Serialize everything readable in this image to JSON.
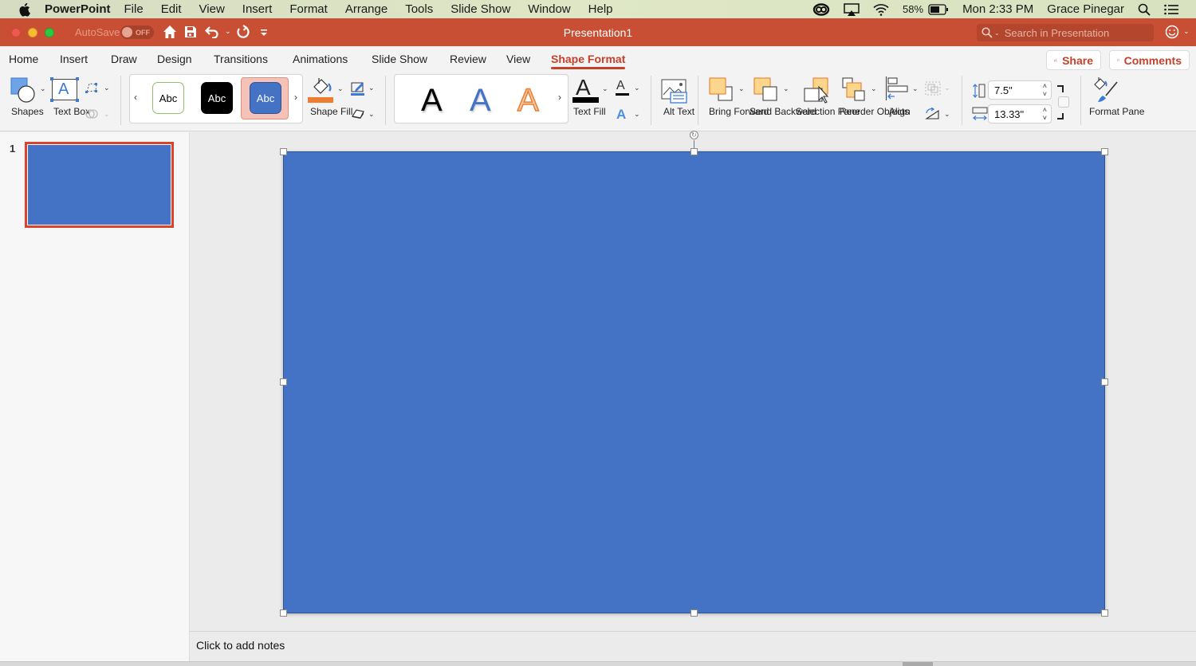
{
  "menubar": {
    "app_name": "PowerPoint",
    "items": [
      "File",
      "Edit",
      "View",
      "Insert",
      "Format",
      "Arrange",
      "Tools",
      "Slide Show",
      "Window",
      "Help"
    ],
    "battery": "58%",
    "clock": "Mon 2:33 PM",
    "user": "Grace Pinegar"
  },
  "titlebar": {
    "autosave_label": "AutoSave",
    "autosave_state": "OFF",
    "title": "Presentation1",
    "search_placeholder": "Search in Presentation"
  },
  "ribbon_tabs": {
    "tabs": [
      "Home",
      "Insert",
      "Draw",
      "Design",
      "Transitions",
      "Animations",
      "Slide Show",
      "Review",
      "View",
      "Shape Format"
    ],
    "active": "Shape Format",
    "share_label": "Share",
    "comments_label": "Comments"
  },
  "ribbon": {
    "shapes_label": "Shapes",
    "text_box_label": "Text Box",
    "shape_styles": [
      "Abc",
      "Abc",
      "Abc"
    ],
    "shape_fill_label": "Shape Fill",
    "wordart_styles": [
      "A",
      "A",
      "A"
    ],
    "text_fill_label": "Text Fill",
    "alt_text_label": "Alt Text",
    "bring_forward_label": "Bring Forward",
    "send_backward_label": "Send Backward",
    "selection_pane_label": "Selection Pane",
    "reorder_objects_label": "Reorder Objects",
    "align_label": "Align",
    "height_value": "7.5\"",
    "width_value": "13.33\"",
    "format_pane_label": "Format Pane"
  },
  "thumbnails": [
    {
      "number": "1",
      "selected": true
    }
  ],
  "slide": {
    "shape_fill": "#4472c4"
  },
  "notes": {
    "placeholder": "Click to add notes"
  },
  "colors": {
    "accent": "#c4422b",
    "titlebar": "#c84f33",
    "shape_blue": "#4472c4"
  }
}
